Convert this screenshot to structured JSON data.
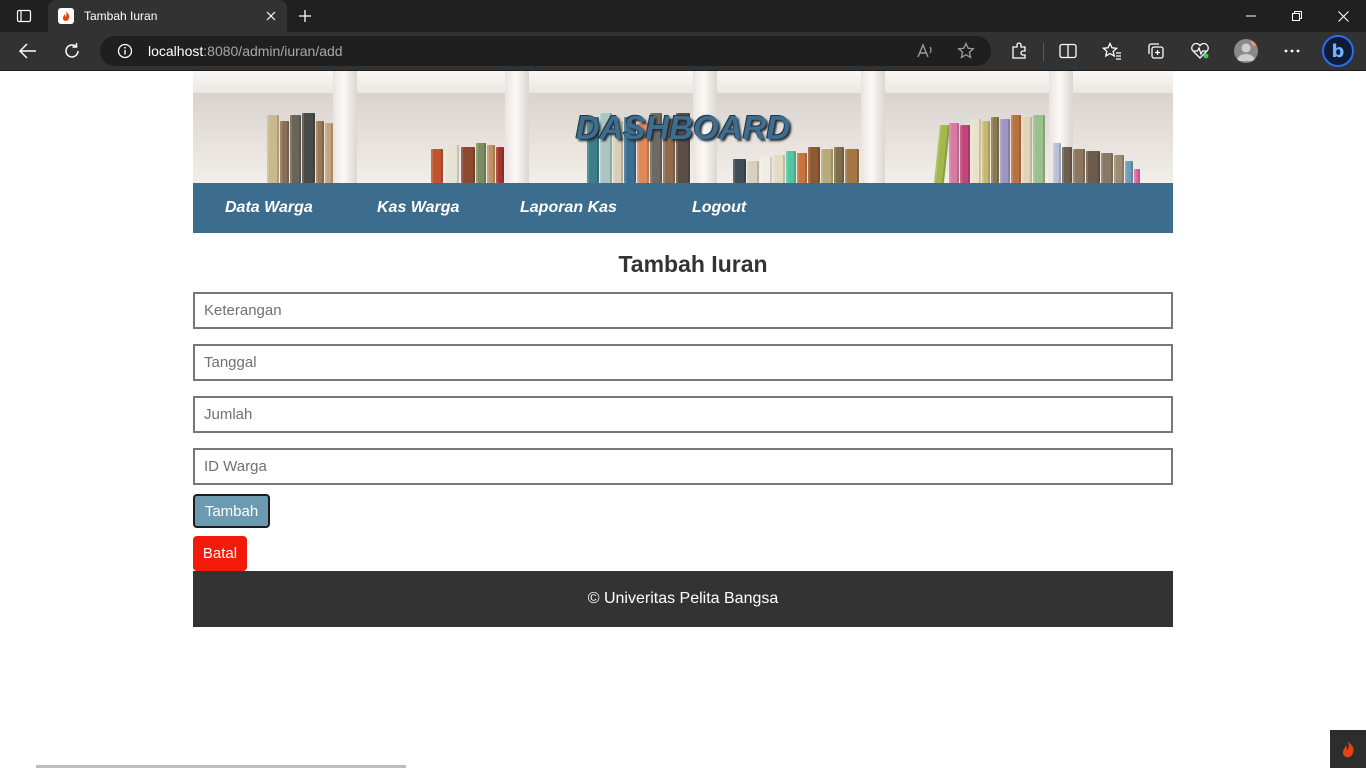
{
  "browser": {
    "tab_title": "Tambah Iuran",
    "url_host": "localhost",
    "url_path": ":8080/admin/iuran/add"
  },
  "header": {
    "banner_title": "DASHBOARD"
  },
  "nav": {
    "items": [
      {
        "label": "Data Warga"
      },
      {
        "label": "Kas Warga"
      },
      {
        "label": "Laporan Kas"
      },
      {
        "label": "Logout"
      }
    ]
  },
  "form": {
    "title": "Tambah Iuran",
    "fields": [
      {
        "placeholder": "Keterangan",
        "value": ""
      },
      {
        "placeholder": "Tanggal",
        "value": ""
      },
      {
        "placeholder": "Jumlah",
        "value": ""
      },
      {
        "placeholder": "ID Warga",
        "value": ""
      }
    ],
    "submit_label": "Tambah",
    "cancel_label": "Batal"
  },
  "footer": {
    "text": "© Univeritas Pelita Bangsa"
  },
  "colors": {
    "nav_bg": "#3d6d8e",
    "submit_bg": "#6b9ab1",
    "cancel_bg": "#f21a0a",
    "footer_bg": "#333333"
  }
}
